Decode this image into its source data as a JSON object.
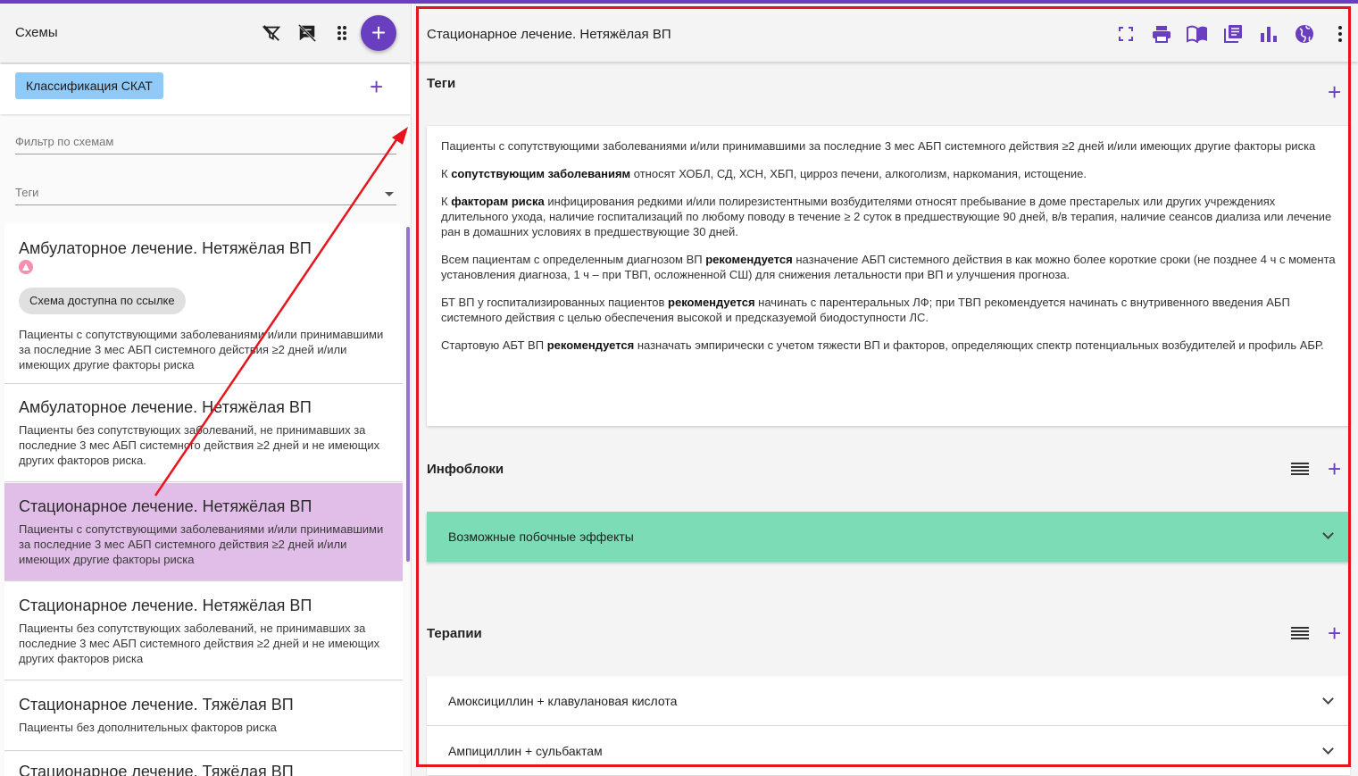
{
  "colors": {
    "accent": "#6a3fbf",
    "selected_card": "#e1bee7",
    "chip_blue": "#90caf9",
    "green_panel": "#7bdcb5",
    "annotation": "#e8141d"
  },
  "left": {
    "title": "Схемы",
    "icons": [
      "filter-off-icon",
      "comment-off-icon",
      "drag-dots-icon",
      "add-icon"
    ],
    "classification_chip": "Классификация СКАТ",
    "filter_placeholder": "Фильтр по схемам",
    "tags_label": "Теги",
    "items": [
      {
        "title": "Амбулаторное лечение. Нетяжёлая ВП",
        "chip": "Схема доступна по ссылке",
        "desc": "Пациенты с сопутствующими заболеваниями и/или принимавшими за последние 3 мес АБП системного действия ≥2 дней и/или имеющих другие факторы риска"
      },
      {
        "title": "Амбулаторное лечение. Нетяжёлая ВП",
        "desc": "Пациенты без сопутствующих заболеваний, не принимавших за последние 3 мес АБП системного действия ≥2 дней и не имеющих других факторов риска."
      },
      {
        "title": "Стационарное лечение. Нетяжёлая ВП",
        "desc": "Пациенты с сопутствующими заболеваниями и/или принимавшими за последние 3 мес АБП системного действия ≥2 дней и/или имеющих другие факторы риска"
      },
      {
        "title": "Стационарное лечение. Нетяжёлая ВП",
        "desc": "Пациенты без сопутствующих заболеваний, не принимавших за последние 3 мес АБП системного действия ≥2 дней и не имеющих других факторов риска"
      },
      {
        "title": "Стационарное лечение. Тяжёлая ВП",
        "desc": "Пациенты без дополнительных факторов риска"
      },
      {
        "title": "Стационарное лечение. Тяжёлая ВП"
      }
    ]
  },
  "right": {
    "title": "Стационарное лечение. Нетяжёлая ВП",
    "icons": [
      "fullscreen-icon",
      "print-icon",
      "book-icon",
      "library-icon",
      "bar-chart-icon",
      "globe-icon",
      "more-vert-icon"
    ],
    "tags_section": "Теги",
    "description": [
      {
        "parts": [
          "Пациенты с сопутствующими заболеваниями и/или принимавшими за последние 3 мес АБП системного действия ≥2 дней и/или имеющих другие факторы риска"
        ]
      },
      {
        "parts": [
          "К ",
          "сопутствующим заболеваниям",
          " относят ХОБЛ, СД, ХСН, ХБП, цирроз печени, алкоголизм, наркомания, истощение."
        ]
      },
      {
        "parts": [
          "К ",
          "факторам риска",
          " инфицирования редкими и/или полирезистентными возбудителями относят пребывание в доме престарелых или других учреждениях длительного ухода, наличие госпитализаций по любому поводу в течение ≥ 2 суток в предшествующие 90 дней, в/в терапия, наличие сеансов диализа или лечение ран в домашних условиях в предшествующие 30 дней."
        ]
      },
      {
        "parts": [
          "Всем пациентам с определенным диагнозом ВП ",
          "рекомендуется",
          " назначение АБП системного действия в как можно более короткие сроки (не позднее 4 ч с момента установления диагноза, 1 ч – при ТВП, осложненной СШ) для снижения летальности при ВП и улучшения прогноза."
        ]
      },
      {
        "parts": [
          "БТ ВП у госпитализированных пациентов ",
          "рекомендуется",
          " начинать с парентеральных ЛФ; при ТВП рекомендуется начинать с внутривенного введения АБП системного действия с целью обеспечения высокой и предсказуемой биодоступности ЛС."
        ]
      },
      {
        "parts": [
          "Стартовую АБТ ВП ",
          "рекомендуется",
          " назначать эмпирически с учетом тяжести ВП и факторов, определяющих спектр потенциальных возбудителей и профиль АБР."
        ]
      }
    ],
    "infoblocks_section": "Инфоблоки",
    "infoblock_item": "Возможные побочные эффекты",
    "therapies_section": "Терапии",
    "therapies": [
      "Амоксициллин + клавулановая кислота",
      "Ампициллин + сульбактам"
    ]
  }
}
